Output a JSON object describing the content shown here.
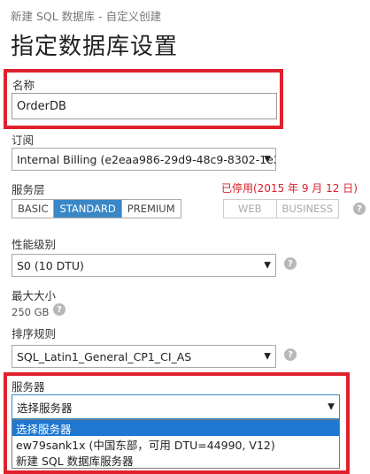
{
  "breadcrumb": "新建 SQL 数据库 - 自定义创建",
  "page_title": "指定数据库设置",
  "name_field": {
    "label": "名称",
    "value": "OrderDB"
  },
  "subscription": {
    "label": "订阅",
    "value": "Internal Billing (e2eaa986-29d9-48c9-8302-1e2’"
  },
  "service_tier": {
    "label": "服务层",
    "options_active": [
      "BASIC",
      "STANDARD",
      "PREMIUM"
    ],
    "selected": "STANDARD",
    "deprecated_note": "已停用(2015 年 9 月 12 日)",
    "options_disabled": [
      "WEB",
      "BUSINESS"
    ]
  },
  "performance": {
    "label": "性能级别",
    "value": "S0 (10 DTU)"
  },
  "max_size": {
    "label": "最大大小",
    "value": "250 GB"
  },
  "collation": {
    "label": "排序规则",
    "value": "SQL_Latin1_General_CP1_CI_AS"
  },
  "server": {
    "label": "服务器",
    "value": "选择服务器",
    "options": [
      "选择服务器",
      "ew79sank1x (中国东部，可用 DTU=44990, V12)",
      "新建 SQL 数据库服务器"
    ]
  },
  "help_glyph": "?",
  "arrow_glyph": "▼",
  "colors": {
    "accent": "#3a87c8",
    "highlight_frame": "#e0212d",
    "deprecated": "#d9202a",
    "list_highlight": "#1e78d0"
  }
}
